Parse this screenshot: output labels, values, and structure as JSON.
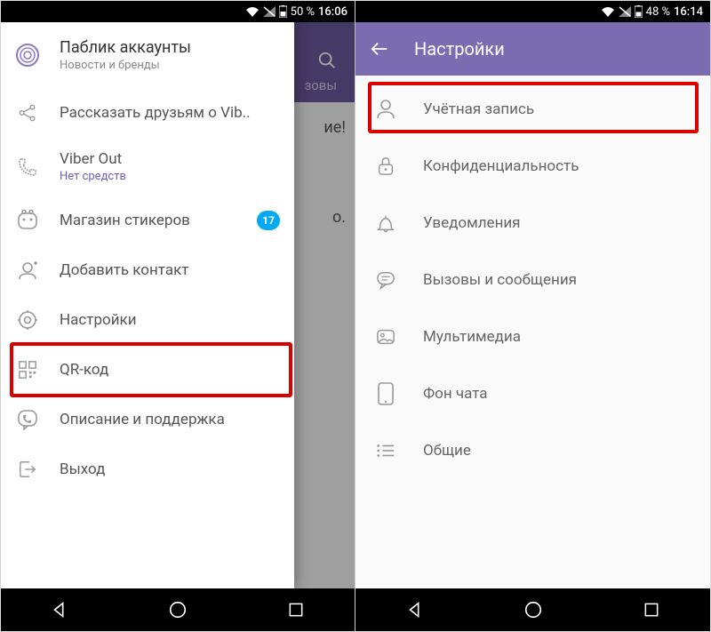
{
  "left": {
    "status": {
      "battery": "50 %",
      "time": "16:06"
    },
    "bg": {
      "tab": "зовы",
      "line1": "ие!",
      "line2": "о."
    },
    "drawer": {
      "public": {
        "title": "Паблик аккаунты",
        "sub": "Новости и бренды"
      },
      "share": "Рассказать друзьям о Vib..",
      "viberout": {
        "title": "Viber Out",
        "sub": "Нет средств"
      },
      "stickers": {
        "title": "Магазин стикеров",
        "badge": "17"
      },
      "addcontact": "Добавить контакт",
      "settings": "Настройки",
      "qr": "QR-код",
      "support": "Описание и поддержка",
      "exit": "Выход"
    }
  },
  "right": {
    "status": {
      "battery": "48 %",
      "time": "16:14"
    },
    "appbar": {
      "title": "Настройки"
    },
    "items": {
      "account": "Учётная запись",
      "privacy": "Конфиденциальность",
      "notifications": "Уведомления",
      "calls": "Вызовы и сообщения",
      "media": "Мультимедиа",
      "bg": "Фон чата",
      "general": "Общие"
    }
  }
}
